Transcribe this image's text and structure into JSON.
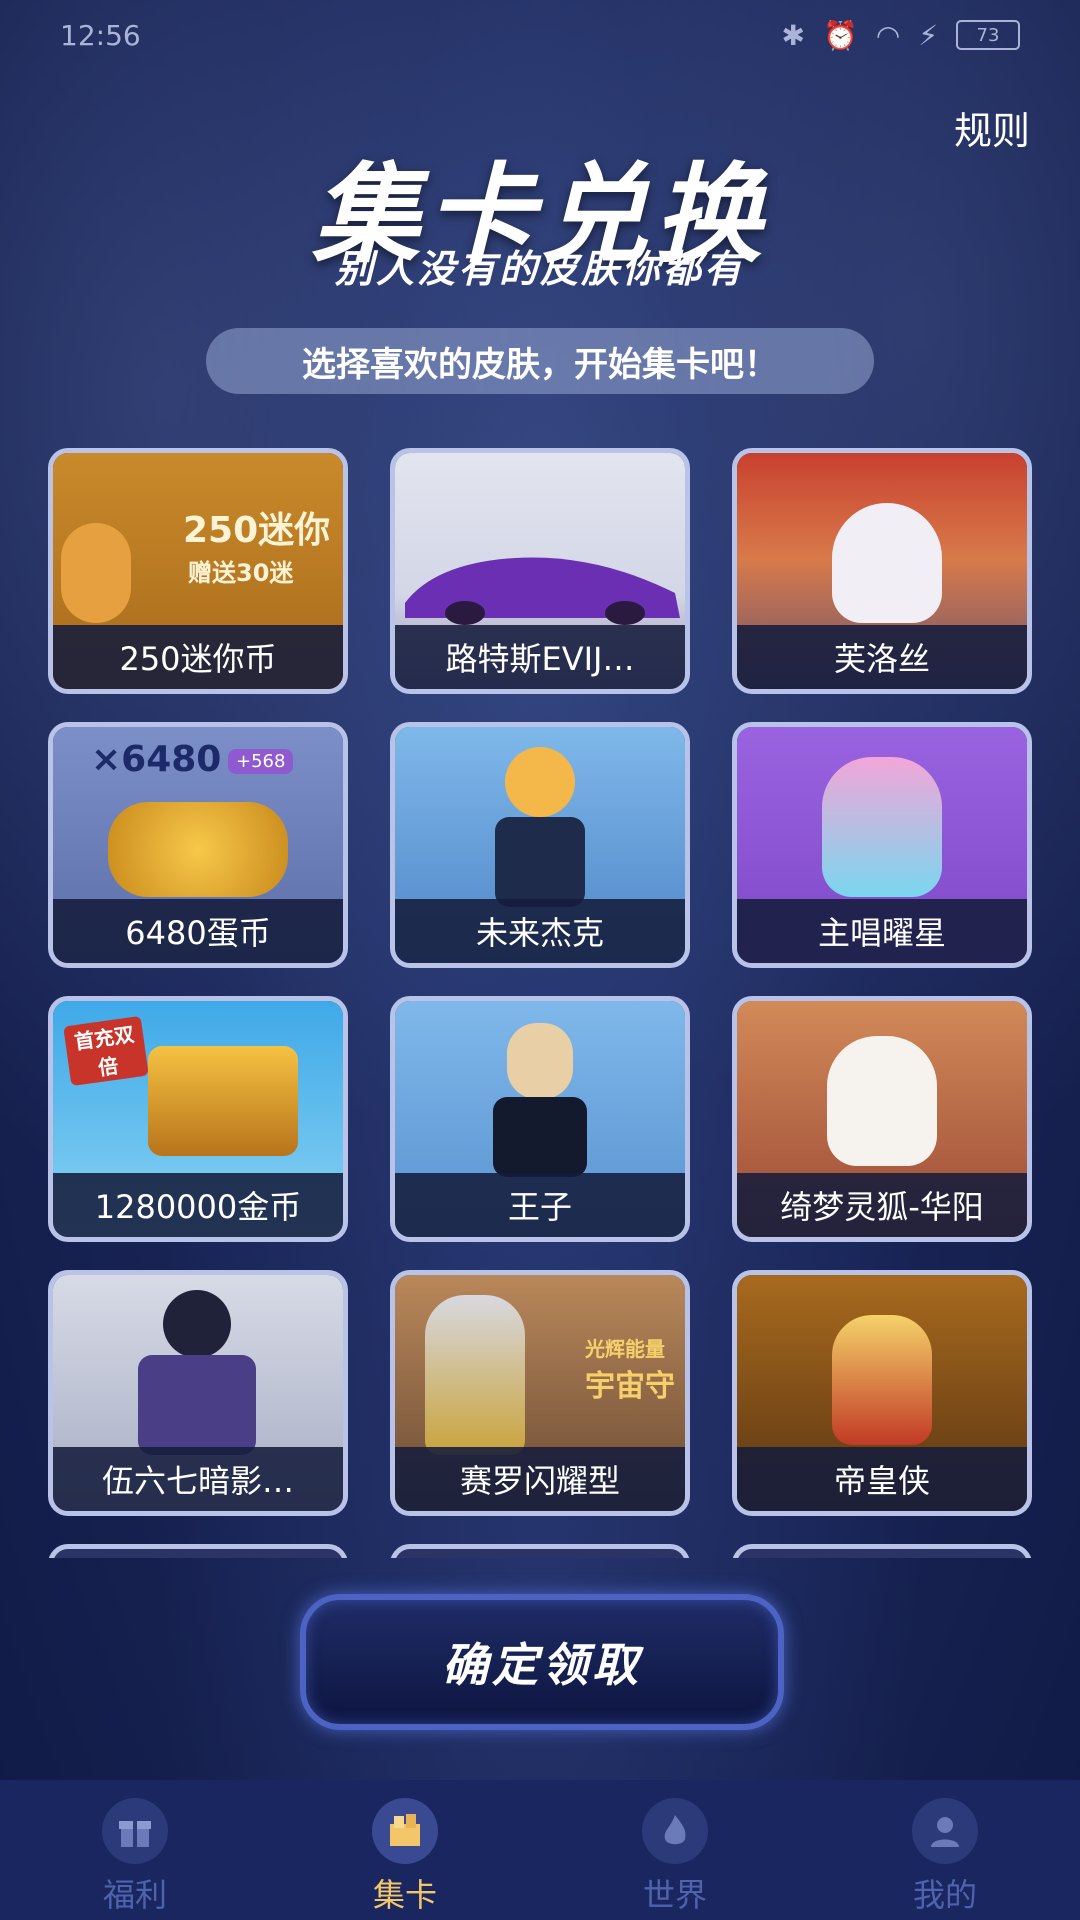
{
  "status_bar": {
    "time": "12:56",
    "battery": "73"
  },
  "header": {
    "rules": "规则",
    "title": "集卡兑换",
    "subtitle": "别人没有的皮肤你都有",
    "hint": "选择喜欢的皮肤，开始集卡吧！"
  },
  "cards": [
    {
      "label": "250迷你币",
      "thumb_text": "250迷你",
      "thumb_sub": "赠送30迷"
    },
    {
      "label": "路特斯EVIJ…"
    },
    {
      "label": "芙洛丝"
    },
    {
      "label": "6480蛋币",
      "thumb_text": "×6480",
      "thumb_badge": "+568"
    },
    {
      "label": "未来杰克"
    },
    {
      "label": "主唱曜星"
    },
    {
      "label": "1280000金币",
      "thumb_badge": "首充双倍"
    },
    {
      "label": "王子"
    },
    {
      "label": "绮梦灵狐-华阳"
    },
    {
      "label": "伍六七暗影…"
    },
    {
      "label": "赛罗闪耀型",
      "thumb_text": "光辉能量",
      "thumb_sub": "宇宙守"
    },
    {
      "label": "帝皇侠"
    }
  ],
  "confirm_button": "确定领取",
  "nav": [
    {
      "label": "福利",
      "icon": "gift-icon"
    },
    {
      "label": "集卡",
      "icon": "card-box-icon",
      "active": true
    },
    {
      "label": "世界",
      "icon": "flame-icon"
    },
    {
      "label": "我的",
      "icon": "user-icon"
    }
  ],
  "colors": {
    "accent": "#f3c66a",
    "card_border": "#b9c3e8",
    "nav_bg": "#1a2660"
  }
}
